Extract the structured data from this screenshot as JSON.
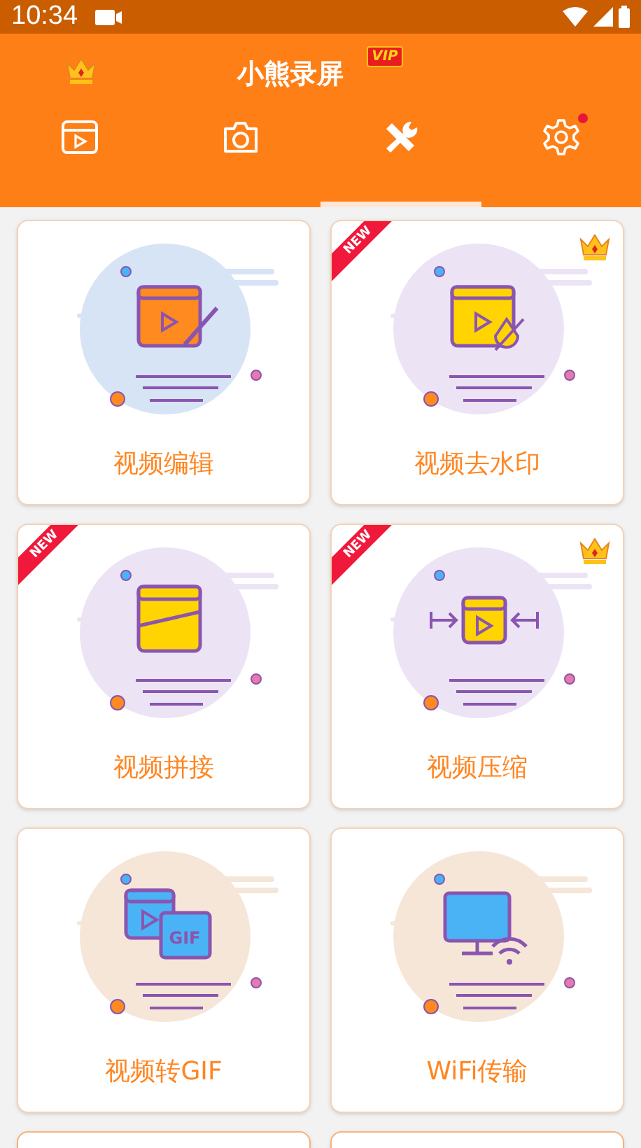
{
  "status_bar": {
    "time": "10:34"
  },
  "header": {
    "title": "小熊录屏",
    "vip_badge": "VIP"
  },
  "tabs": [
    {
      "kind": "video",
      "selected": false
    },
    {
      "kind": "camera",
      "selected": false
    },
    {
      "kind": "tools",
      "selected": true
    },
    {
      "kind": "settings",
      "selected": false,
      "dot": true
    }
  ],
  "cards": [
    {
      "title": "视频编辑",
      "kind": "edit",
      "vip": false,
      "color": "#d6e4f5"
    },
    {
      "title": "视频去水印",
      "kind": "watermark",
      "new_label": "NEW",
      "vip": true,
      "color": "#ece4f5"
    },
    {
      "title": "视频拼接",
      "kind": "merge",
      "new_label": "NEW",
      "vip": false,
      "color": "#ece4f5"
    },
    {
      "title": "视频压缩",
      "kind": "compress",
      "new_label": "NEW",
      "vip": true,
      "color": "#ece4f5"
    },
    {
      "title": "视频转GIF",
      "kind": "gif",
      "icon_text": "GIF",
      "vip": false,
      "color": "#f6e6d8"
    },
    {
      "title": "WiFi传输",
      "kind": "wifi",
      "vip": false,
      "color": "#f6e6d8"
    },
    {
      "kind": "cut"
    },
    {
      "kind": "cut"
    }
  ]
}
